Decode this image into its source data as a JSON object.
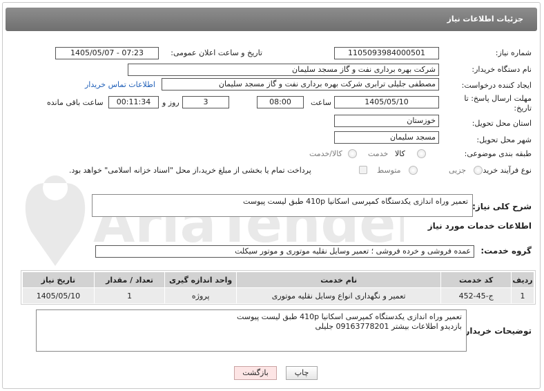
{
  "header": {
    "title": "جزئیات اطلاعات نیاز"
  },
  "fields": {
    "need_number_label": "شماره نیاز:",
    "need_number": "1105093984000501",
    "announce_label": "تاریخ و ساعت اعلان عمومی:",
    "announce_value": "1405/05/07 - 07:23",
    "buyer_org_label": "نام دستگاه خریدار:",
    "buyer_org": "شرکت بهره برداری نفت و گاز مسجد سلیمان",
    "creator_label": "ایجاد کننده درخواست:",
    "creator": "مصطفی جلیلی ترابری شرکت بهره برداری نفت و گاز مسجد سلیمان",
    "contact_link": "اطلاعات تماس خریدار",
    "deadline_label_1": "مهلت ارسال پاسخ: تا",
    "deadline_label_2": "تاریخ:",
    "deadline_date": "1405/05/10",
    "time_label": "ساعت",
    "deadline_time": "08:00",
    "days_value": "3",
    "days_label": "روز و",
    "remaining_time": "00:11:34",
    "remaining_label": "ساعت باقی مانده",
    "province_label": "استان محل تحویل:",
    "province": "خوزستان",
    "city_label": "شهر محل تحویل:",
    "city": "مسجد سلیمان",
    "category_label": "طبقه بندی موضوعی:",
    "category_options": [
      "کالا",
      "خدمت",
      "کالا/خدمت"
    ],
    "process_label": "نوع فرآیند خرید :",
    "process_options": [
      "جزیی",
      "متوسط"
    ],
    "payment_note": "پرداخت تمام یا بخشی از مبلغ خرید،از محل \"اسناد خزانه اسلامی\" خواهد بود."
  },
  "summary": {
    "label": "شرح کلی نیاز:",
    "text": "تعمیر وراه اندازی یکدستگاه کمپرسی اسکانیا 410p طبق لیست پیوست"
  },
  "services": {
    "section_title": "اطلاعات خدمات مورد نیاز",
    "group_label": "گروه خدمت:",
    "group_value": "عمده فروشی و خرده فروشی ؛ تعمیر وسایل نقلیه موتوری و موتور سیکلت",
    "columns": [
      "ردیف",
      "کد خدمت",
      "نام خدمت",
      "واحد اندازه گیری",
      "تعداد / مقدار",
      "تاریخ نیاز"
    ],
    "rows": [
      [
        "1",
        "ج-45-452",
        "تعمیر و نگهداری انواع وسایل نقلیه موتوری",
        "پروژه",
        "1",
        "1405/05/10"
      ]
    ]
  },
  "buyer_notes": {
    "label": "توضیحات خریدار:",
    "line1": "تعمیر وراه اندازی یکدستگاه کمپرسی اسکانیا 410p طبق لیست پیوست",
    "line2": "بازدیدو اطلاعات بیشتر 09163778201 جلیلی"
  },
  "buttons": {
    "print": "چاپ",
    "back": "بازگشت"
  },
  "watermark": {
    "text": "AriaTender.neT"
  },
  "colors": {
    "header": "#7d7d7d",
    "link": "#1f5fb8",
    "table_header": "#d2d2d2",
    "table_row": "#ebebeb",
    "back_button": "#fde5e5"
  }
}
